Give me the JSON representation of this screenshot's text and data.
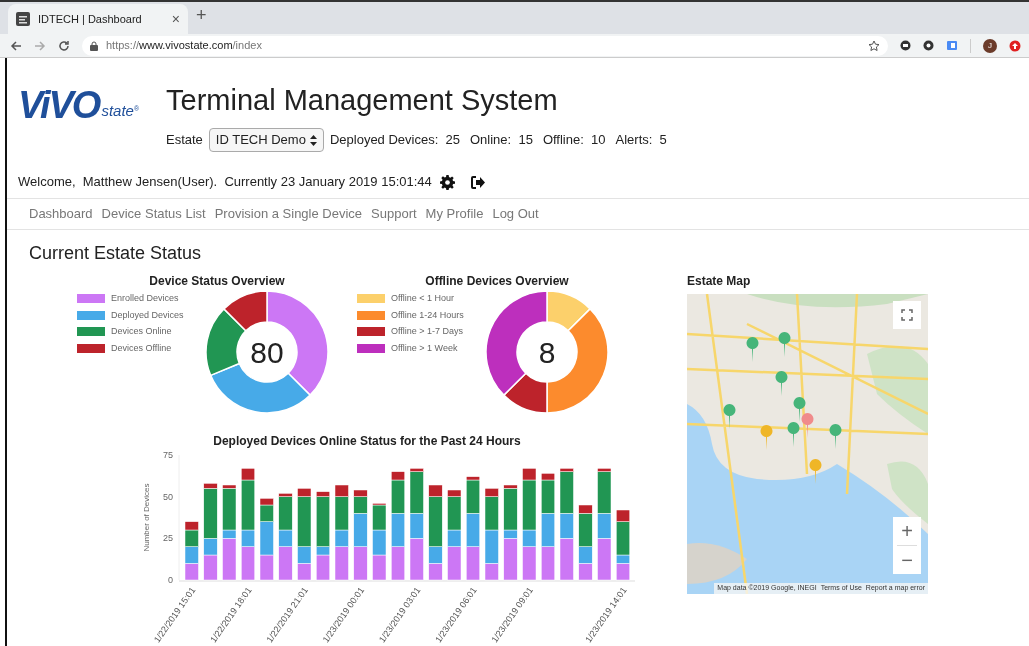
{
  "browser": {
    "tab_title": "IDTECH | Dashboard",
    "tab_close": "×",
    "new_tab": "+",
    "url_scheme": "https://",
    "url_host": "www.vivostate.com",
    "url_path": "/index",
    "profile_initial": "J"
  },
  "logo": {
    "word": "ViVO",
    "suffix": "state",
    "mark": "®"
  },
  "title": "Terminal Management System",
  "estate": {
    "label": "Estate",
    "value": "ID TECH Demo"
  },
  "stats": [
    {
      "label": "Deployed Devices:",
      "value": "25"
    },
    {
      "label": "Online:",
      "value": "15"
    },
    {
      "label": "Offline:",
      "value": "10"
    },
    {
      "label": "Alerts:",
      "value": "5"
    }
  ],
  "welcome": "Welcome,  Matthew Jensen(User).  Currently 23 January 2019 15:01:44",
  "nav": [
    "Dashboard",
    "Device Status List",
    "Provision a Single Device",
    "Support",
    "My Profile",
    "Log Out"
  ],
  "section_title": "Current Estate Status",
  "donuts": [
    {
      "title": "Device Status Overview",
      "center": "80",
      "chart_data": {
        "type": "donut",
        "legend": true,
        "categories": [
          "Enrolled Devices",
          "Deployed Devices",
          "Devices Online",
          "Devices Offline"
        ],
        "values": [
          37.5,
          31.25,
          18.75,
          12.5
        ],
        "colors": [
          "#cc77f5",
          "#47aae8",
          "#219653",
          "#bd232b"
        ]
      }
    },
    {
      "title": "Offline Devices Overview",
      "center": "8",
      "chart_data": {
        "type": "donut",
        "legend": true,
        "categories": [
          "Offline < 1 Hour",
          "Offline 1-24 Hours",
          "Offline > 1-7 Days",
          "Offline > 1 Week"
        ],
        "values": [
          12.5,
          37.5,
          12.5,
          37.5
        ],
        "colors": [
          "#fcd06b",
          "#fc8b2d",
          "#bd232b",
          "#bd2fbd"
        ]
      }
    }
  ],
  "bar_chart": {
    "title": "Deployed Devices Online Status for the Past 24 Hours",
    "chart_data": {
      "type": "bar",
      "stacked": true,
      "ylabel": "Number of Devices",
      "ylim": [
        0,
        75
      ],
      "yticks": [
        0,
        25,
        50,
        75
      ],
      "categories": [
        "1/22/2019 15:01",
        null,
        null,
        "1/22/2019 18:01",
        null,
        null,
        "1/22/2019 21:01",
        null,
        null,
        "1/23/2019 00:01",
        null,
        null,
        "1/23/2019 03:01",
        null,
        null,
        "1/23/2019 06:01",
        null,
        null,
        "1/23/2019 09:01",
        null,
        null,
        null,
        null,
        "1/23/2019 14:01"
      ],
      "series": [
        {
          "color": "#cc77f5",
          "values": [
            10,
            15,
            25,
            20,
            15,
            20,
            10,
            15,
            20,
            20,
            15,
            20,
            25,
            10,
            20,
            20,
            10,
            25,
            20,
            20,
            25,
            10,
            25,
            10
          ]
        },
        {
          "color": "#47aae8",
          "values": [
            10,
            10,
            5,
            10,
            20,
            10,
            10,
            5,
            10,
            20,
            15,
            20,
            15,
            10,
            10,
            20,
            20,
            5,
            10,
            20,
            15,
            10,
            15,
            5
          ]
        },
        {
          "color": "#219653",
          "values": [
            10,
            30,
            25,
            30,
            10,
            20,
            30,
            30,
            20,
            10,
            15,
            20,
            25,
            30,
            20,
            20,
            20,
            25,
            30,
            20,
            25,
            20,
            25,
            20
          ]
        },
        {
          "color": "#bd232b",
          "values": [
            5,
            3,
            2,
            7,
            4,
            2,
            5,
            3,
            7,
            4,
            1,
            5,
            2,
            7,
            4,
            2,
            5,
            2,
            7,
            4,
            2,
            5,
            2,
            7
          ]
        }
      ]
    }
  },
  "map": {
    "title": "Estate Map",
    "zoom_in": "+",
    "zoom_out": "−",
    "attribution": [
      "Map data ©2019 Google, INEGI",
      "Terms of Use",
      "Report a map error"
    ],
    "kind": "picture"
  }
}
